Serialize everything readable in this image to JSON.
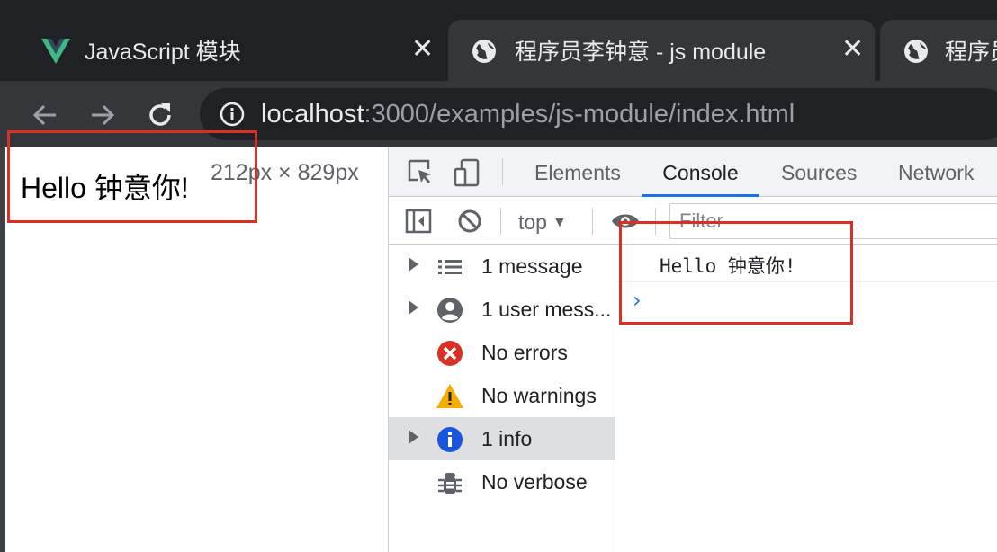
{
  "browser": {
    "tabs": [
      {
        "title": "JavaScript 模块",
        "icon": "vue-logo-icon",
        "close": "✕"
      },
      {
        "title": "程序员李钟意 - js module",
        "icon": "globe-icon",
        "close": "✕"
      },
      {
        "title": "程序员",
        "icon": "globe-icon"
      }
    ],
    "url_host": "localhost",
    "url_rest": ":3000/examples/js-module/index.html"
  },
  "page": {
    "text": "Hello 钟意你!",
    "dimensions": "212px × 829px"
  },
  "devtools": {
    "tabs": {
      "elements": "Elements",
      "console": "Console",
      "sources": "Sources",
      "network": "Network"
    },
    "active_tab": "Console",
    "console_toolbar": {
      "context": "top",
      "caret": "▼",
      "filter_placeholder": "Filter"
    },
    "sidebar": [
      {
        "label": "1 message",
        "icon": "list-icon",
        "expandable": true
      },
      {
        "label": "1 user mess...",
        "icon": "user-icon",
        "expandable": true
      },
      {
        "label": "No errors",
        "icon": "error-icon",
        "expandable": false
      },
      {
        "label": "No warnings",
        "icon": "warning-icon",
        "expandable": false
      },
      {
        "label": "1 info",
        "icon": "info-icon",
        "expandable": true,
        "selected": true
      },
      {
        "label": "No verbose",
        "icon": "bug-icon",
        "expandable": false
      }
    ],
    "console_output": [
      {
        "message": "Hello 钟意你!"
      }
    ],
    "prompt": "›"
  },
  "colors": {
    "accent": "#1a73e8",
    "annotation": "#d93025",
    "error": "#d93025",
    "warning": "#f9ab00",
    "info": "#1a73e8",
    "vue_green": "#41b883"
  }
}
